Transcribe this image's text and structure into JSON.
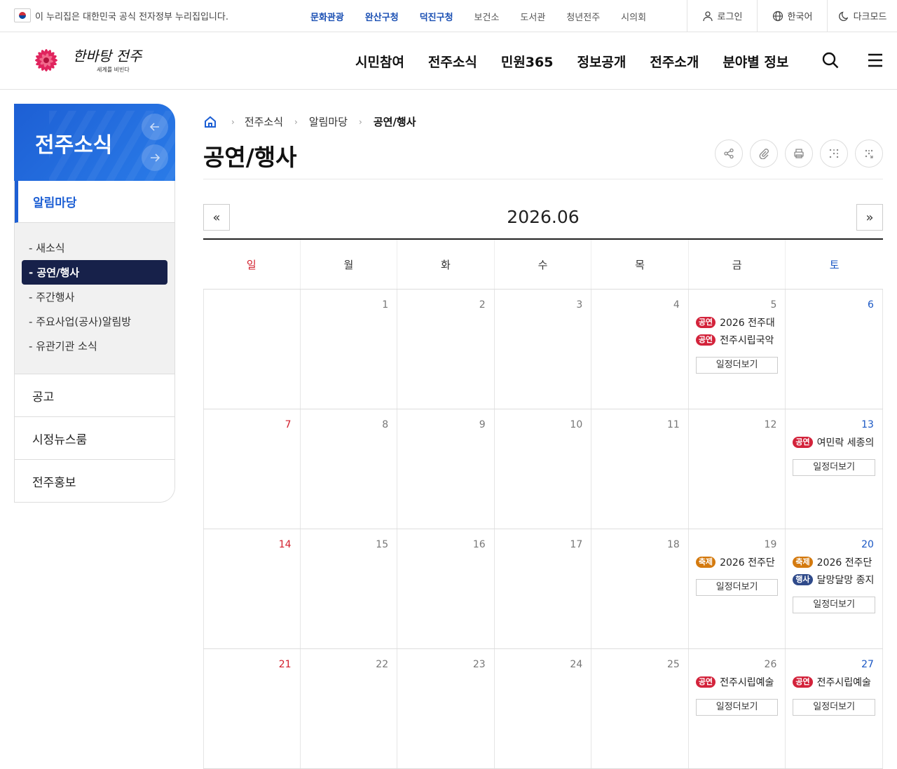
{
  "topbar": {
    "notice": "이 누리집은 대한민국 공식 전자정부 누리집입니다.",
    "sites": [
      {
        "label": "문화관광",
        "highlight": true
      },
      {
        "label": "완산구청",
        "highlight": true
      },
      {
        "label": "덕진구청",
        "highlight": true
      },
      {
        "label": "보건소",
        "highlight": false
      },
      {
        "label": "도서관",
        "highlight": false
      },
      {
        "label": "청년전주",
        "highlight": false
      },
      {
        "label": "시의회",
        "highlight": false
      }
    ],
    "login": "로그인",
    "language": "한국어",
    "darkmode": "다크모드"
  },
  "logo": {
    "main": "한바탕 전주",
    "sub": "세계를 비빈다"
  },
  "gnb": [
    "시민참여",
    "전주소식",
    "민원365",
    "정보공개",
    "전주소개",
    "분야별 정보"
  ],
  "sidebar": {
    "title": "전주소식",
    "current": "알림마당",
    "sub_items": [
      {
        "label": "새소식",
        "active": false
      },
      {
        "label": "공연/행사",
        "active": true
      },
      {
        "label": "주간행사",
        "active": false
      },
      {
        "label": "주요사업(공사)알림방",
        "active": false
      },
      {
        "label": "유관기관 소식",
        "active": false
      }
    ],
    "menus": [
      "공고",
      "시정뉴스룸",
      "전주홍보"
    ]
  },
  "breadcrumb": {
    "level1": "전주소식",
    "level2": "알림마당",
    "current": "공연/행사"
  },
  "page_title": "공연/행사",
  "calendar": {
    "month": "2026.06",
    "weekdays": [
      "일",
      "월",
      "화",
      "수",
      "목",
      "금",
      "토"
    ],
    "more_label": "일정더보기",
    "weeks": [
      [
        {
          "day": "",
          "events": []
        },
        {
          "day": "1",
          "events": []
        },
        {
          "day": "2",
          "events": []
        },
        {
          "day": "3",
          "events": []
        },
        {
          "day": "4",
          "events": []
        },
        {
          "day": "5",
          "events": [
            {
              "tag": "공연",
              "kind": "perf",
              "title": "2026 전주대"
            },
            {
              "tag": "공연",
              "kind": "perf",
              "title": "전주시립국악"
            }
          ],
          "more": true
        },
        {
          "day": "6",
          "events": []
        }
      ],
      [
        {
          "day": "7",
          "events": []
        },
        {
          "day": "8",
          "events": []
        },
        {
          "day": "9",
          "events": []
        },
        {
          "day": "10",
          "events": []
        },
        {
          "day": "11",
          "events": []
        },
        {
          "day": "12",
          "events": []
        },
        {
          "day": "13",
          "events": [
            {
              "tag": "공연",
              "kind": "perf",
              "title": "여민락 세종의"
            }
          ],
          "more": true
        }
      ],
      [
        {
          "day": "14",
          "events": []
        },
        {
          "day": "15",
          "events": []
        },
        {
          "day": "16",
          "events": []
        },
        {
          "day": "17",
          "events": []
        },
        {
          "day": "18",
          "events": []
        },
        {
          "day": "19",
          "events": [
            {
              "tag": "축제",
              "kind": "fest",
              "title": "2026 전주단"
            }
          ],
          "more": true
        },
        {
          "day": "20",
          "events": [
            {
              "tag": "축제",
              "kind": "fest",
              "title": "2026 전주단"
            },
            {
              "tag": "행사",
              "kind": "event",
              "title": "달망달망 종지"
            }
          ],
          "more": true
        }
      ],
      [
        {
          "day": "21",
          "events": []
        },
        {
          "day": "22",
          "events": []
        },
        {
          "day": "23",
          "events": []
        },
        {
          "day": "24",
          "events": []
        },
        {
          "day": "25",
          "events": []
        },
        {
          "day": "26",
          "events": [
            {
              "tag": "공연",
              "kind": "perf",
              "title": "전주시립예술"
            }
          ],
          "more": true
        },
        {
          "day": "27",
          "events": [
            {
              "tag": "공연",
              "kind": "perf",
              "title": "전주시립예술"
            }
          ],
          "more": true
        }
      ]
    ]
  }
}
